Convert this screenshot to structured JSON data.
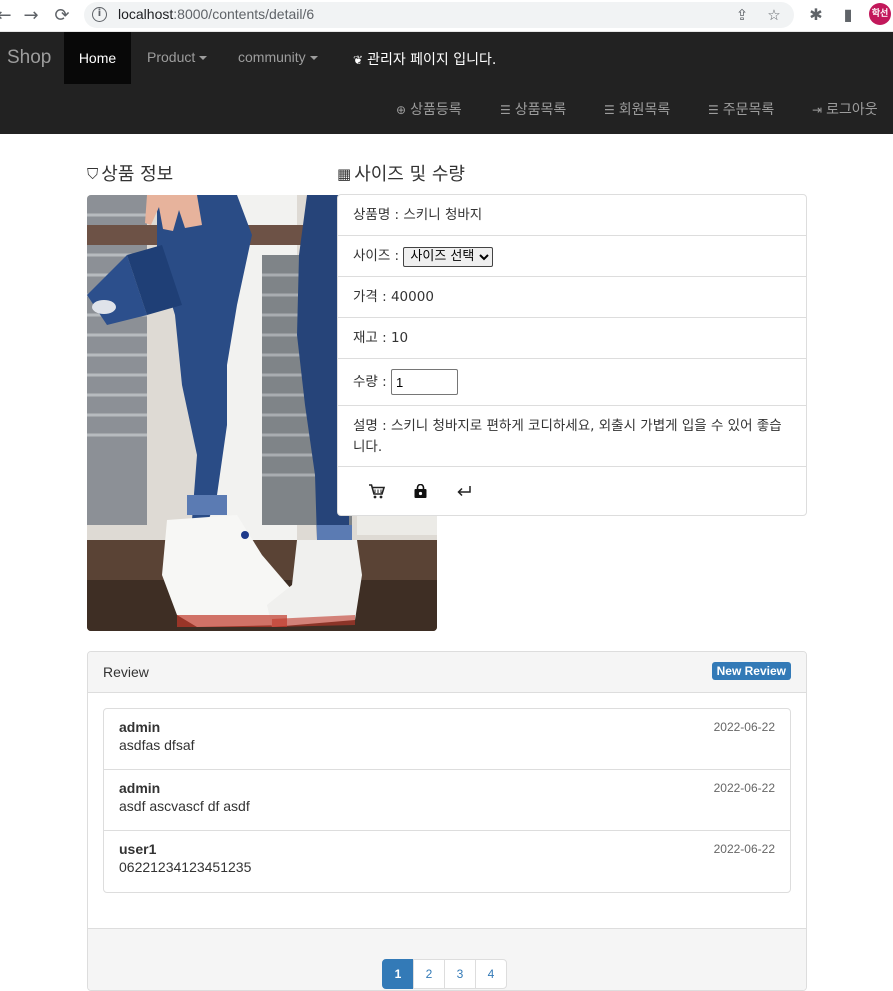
{
  "browser": {
    "url_host": "localhost",
    "url_path": ":8000/contents/detail/6",
    "profile_initials": "학선"
  },
  "navbar": {
    "brand": "Shop",
    "home": "Home",
    "product": "Product",
    "community": "community",
    "admin_note": "관리자 페이지 입니다.",
    "right_links": [
      {
        "label": "상품등록",
        "icon": "plus-circle-icon"
      },
      {
        "label": "상품목록",
        "icon": "list-icon"
      },
      {
        "label": "회원목록",
        "icon": "list-icon"
      },
      {
        "label": "주문목록",
        "icon": "list-icon"
      },
      {
        "label": "로그아웃",
        "icon": "logout-icon"
      }
    ]
  },
  "sections": {
    "product_info_title": "상품 정보",
    "size_qty_title": "사이즈 및 수량"
  },
  "product": {
    "name_row": "상품명 : 스키니 청바지",
    "size_label": "사이즈 :",
    "size_selected": "사이즈 선택",
    "price_row": "가격 : 40000",
    "stock_row": "재고 : 10",
    "qty_label": "수량 :",
    "qty_value": "1",
    "desc_row": "설명 : 스키니 청바지로 편하게 코디하세요, 외출시 가볍게 입을 수 있어 좋습니다."
  },
  "reviews": {
    "title": "Review",
    "new_button": "New Review",
    "items": [
      {
        "author": "admin",
        "text": "asdfas dfsaf",
        "date": "2022-06-22"
      },
      {
        "author": "admin",
        "text": "asdf ascvascf df asdf",
        "date": "2022-06-22"
      },
      {
        "author": "user1",
        "text": "06221234123451235",
        "date": "2022-06-22"
      }
    ],
    "pages": [
      "1",
      "2",
      "3",
      "4"
    ],
    "current_page": "1"
  },
  "colors": {
    "navbar_bg": "#222222",
    "accent": "#337ab7"
  }
}
